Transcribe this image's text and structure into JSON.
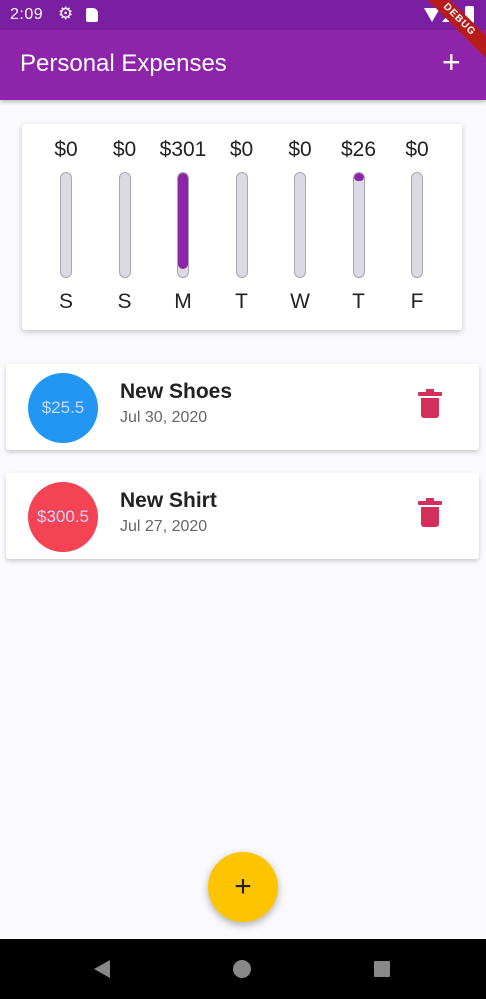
{
  "status_bar": {
    "time": "2:09"
  },
  "app_bar": {
    "title": "Personal Expenses",
    "debug_label": "DEBUG"
  },
  "chart_data": {
    "type": "bar",
    "categories": [
      "S",
      "S",
      "M",
      "T",
      "W",
      "T",
      "F"
    ],
    "value_labels": [
      "$0",
      "$0",
      "$301",
      "$0",
      "$0",
      "$26",
      "$0"
    ],
    "values": [
      0,
      0,
      301,
      0,
      0,
      26,
      0
    ],
    "fill_fractions": [
      0,
      0,
      0.92,
      0,
      0,
      0.08,
      0
    ],
    "colors": {
      "fill": "#8e24aa",
      "track": "#dcd9e2"
    }
  },
  "transactions": [
    {
      "amount": "$25.5",
      "title": "New Shoes",
      "date": "Jul 30, 2020",
      "color": "#2196f3"
    },
    {
      "amount": "$300.5",
      "title": "New Shirt",
      "date": "Jul 27, 2020",
      "color": "#f44352"
    }
  ],
  "icons": {
    "add": "plus-icon",
    "delete": "trash-icon",
    "fab": "plus-icon",
    "nav": [
      "back-icon",
      "home-icon",
      "recents-icon"
    ]
  },
  "colors": {
    "primary": "#8e24aa",
    "accent": "#ffc400",
    "delete": "#d32f5a"
  }
}
